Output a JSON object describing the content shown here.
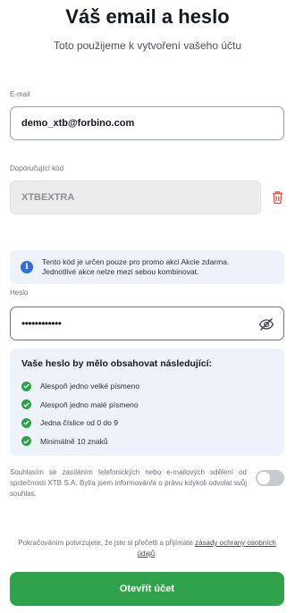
{
  "header": {
    "title": "Váš email a heslo",
    "subtitle": "Toto použijeme k vytvoření vašeho účtu"
  },
  "email": {
    "label": "E-mail",
    "value": "demo_xtb@forbino.com"
  },
  "referral": {
    "label": "Doporučující kód",
    "value": "XTBEXTRA",
    "delete_icon": "trash-icon"
  },
  "promo_info": {
    "icon": "info-icon",
    "line1": "Tento kód je určen pouze pro promo akci Akcie zdarma.",
    "line2": "Jednotlivé akce nelze mezi sebou kombinovat."
  },
  "password": {
    "label": "Heslo",
    "value": "••••••••••••",
    "toggle_icon": "eye-off-icon"
  },
  "requirements": {
    "title": "Vaše heslo by mělo obsahovat následující:",
    "items": [
      "Alespoň jedno velké písmeno",
      "Alespoň jedno malé písmeno",
      "Jedna číslice od 0 do 9",
      "Minimálně 10 znaků"
    ],
    "check_color": "#2fa04a"
  },
  "consent": {
    "text": "Souhlasím se zasíláním telefonických nebo e-mailových sdělení od společnosti XTB S.A. Byl/a jsem informován/a o právu kdykoli odvolat svůj souhlas.",
    "toggle_on": false
  },
  "terms": {
    "prefix": "Pokračováním potvrzujete, že jste si přečetli a přijímáte ",
    "link": "zásady ochrany osobních údajů",
    "suffix": "."
  },
  "submit": {
    "label": "Otevřít účet",
    "color": "#31a24c"
  }
}
